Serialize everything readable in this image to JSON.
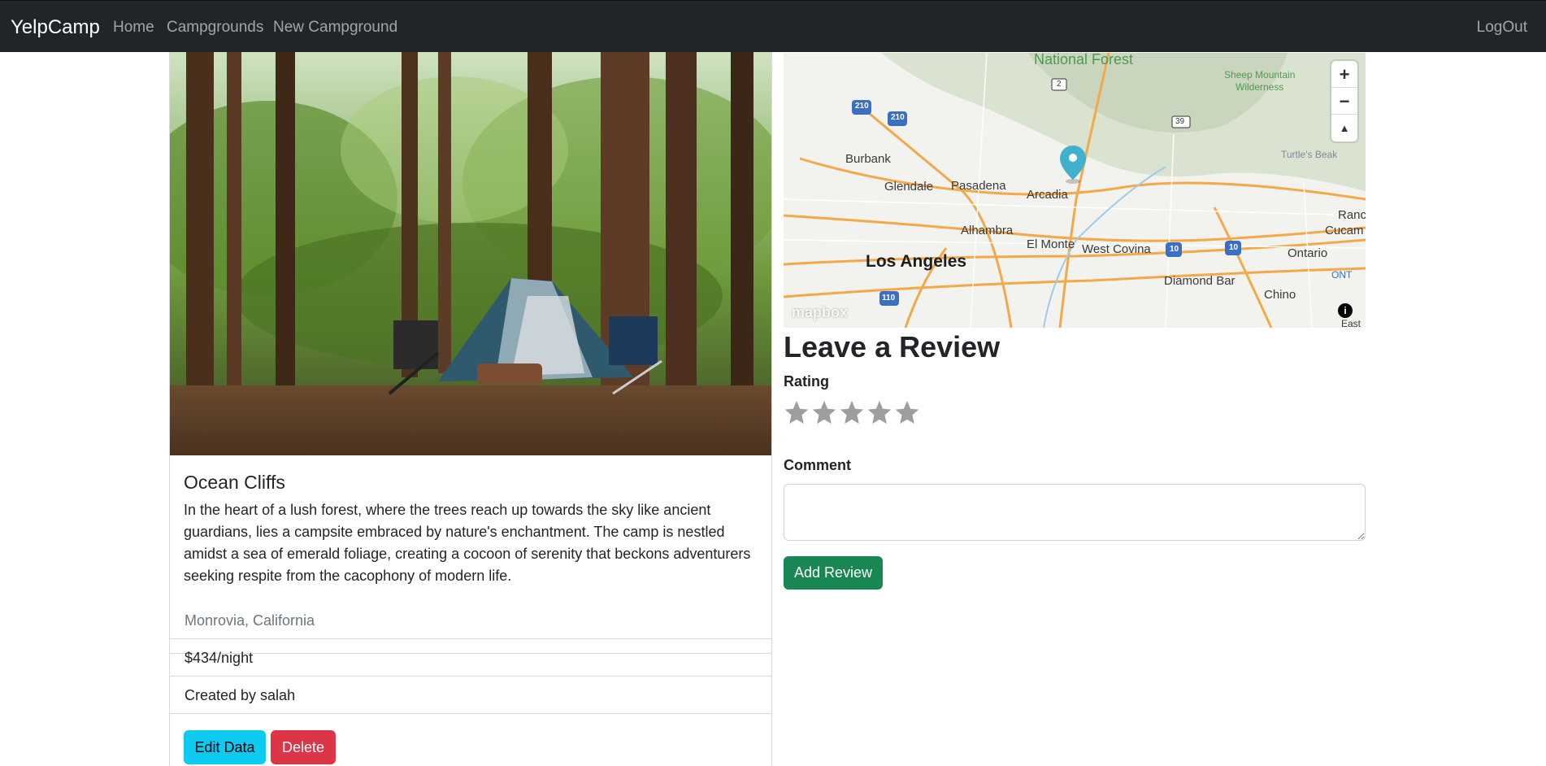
{
  "navbar": {
    "brand": "YelpCamp",
    "links": [
      "Home",
      "Campgrounds",
      "New Campground"
    ],
    "logout": "LogOut"
  },
  "campground": {
    "title": "Ocean Cliffs",
    "description": "In the heart of a lush forest, where the trees reach up towards the sky like ancient guardians, lies a campsite embraced by nature's enchantment. The camp is nestled amidst a sea of emerald foliage, creating a cocoon of serenity that beckons adventurers seeking respite from the cacophony of modern life.",
    "location": "Monrovia, California",
    "price": "$434/night",
    "author": "Created by salah",
    "edit_label": "Edit Data",
    "delete_label": "Delete"
  },
  "map": {
    "labels": {
      "national_forest": "National Forest",
      "sheep_mountain": "Sheep Mountain",
      "wilderness": "Wilderness",
      "turtles_beak": "Turtle's Beak",
      "burbank": "Burbank",
      "glendale": "Glendale",
      "pasadena": "Pasadena",
      "arcadia": "Arcadia",
      "alhambra": "Alhambra",
      "el_monte": "El Monte",
      "west_covina": "West Covina",
      "los_angeles": "Los Angeles",
      "ontario": "Ontario",
      "ont": "ONT",
      "diamond_bar": "Diamond Bar",
      "chino": "Chino",
      "ranc": "Ranc",
      "cucam": "Cucam",
      "east": "East",
      "hw_210a": "210",
      "hw_210b": "210",
      "hw_2": "2",
      "hw_39": "39",
      "hw_10a": "10",
      "hw_10b": "10",
      "hw_110": "110"
    },
    "zoom_in": "+",
    "zoom_out": "−",
    "compass": "▲",
    "attribution_logo": "mapbox",
    "info": "i",
    "marker_color": "#3fb1ce"
  },
  "review": {
    "heading": "Leave a Review",
    "rating_label": "Rating",
    "star_count": 5,
    "comment_label": "Comment",
    "comment_value": "",
    "submit_label": "Add Review"
  },
  "colors": {
    "navbar": "#212529",
    "edit_button": "#0dcaf0",
    "delete_button": "#dc3545",
    "submit_button": "#198754",
    "star": "#9e9e9e"
  }
}
